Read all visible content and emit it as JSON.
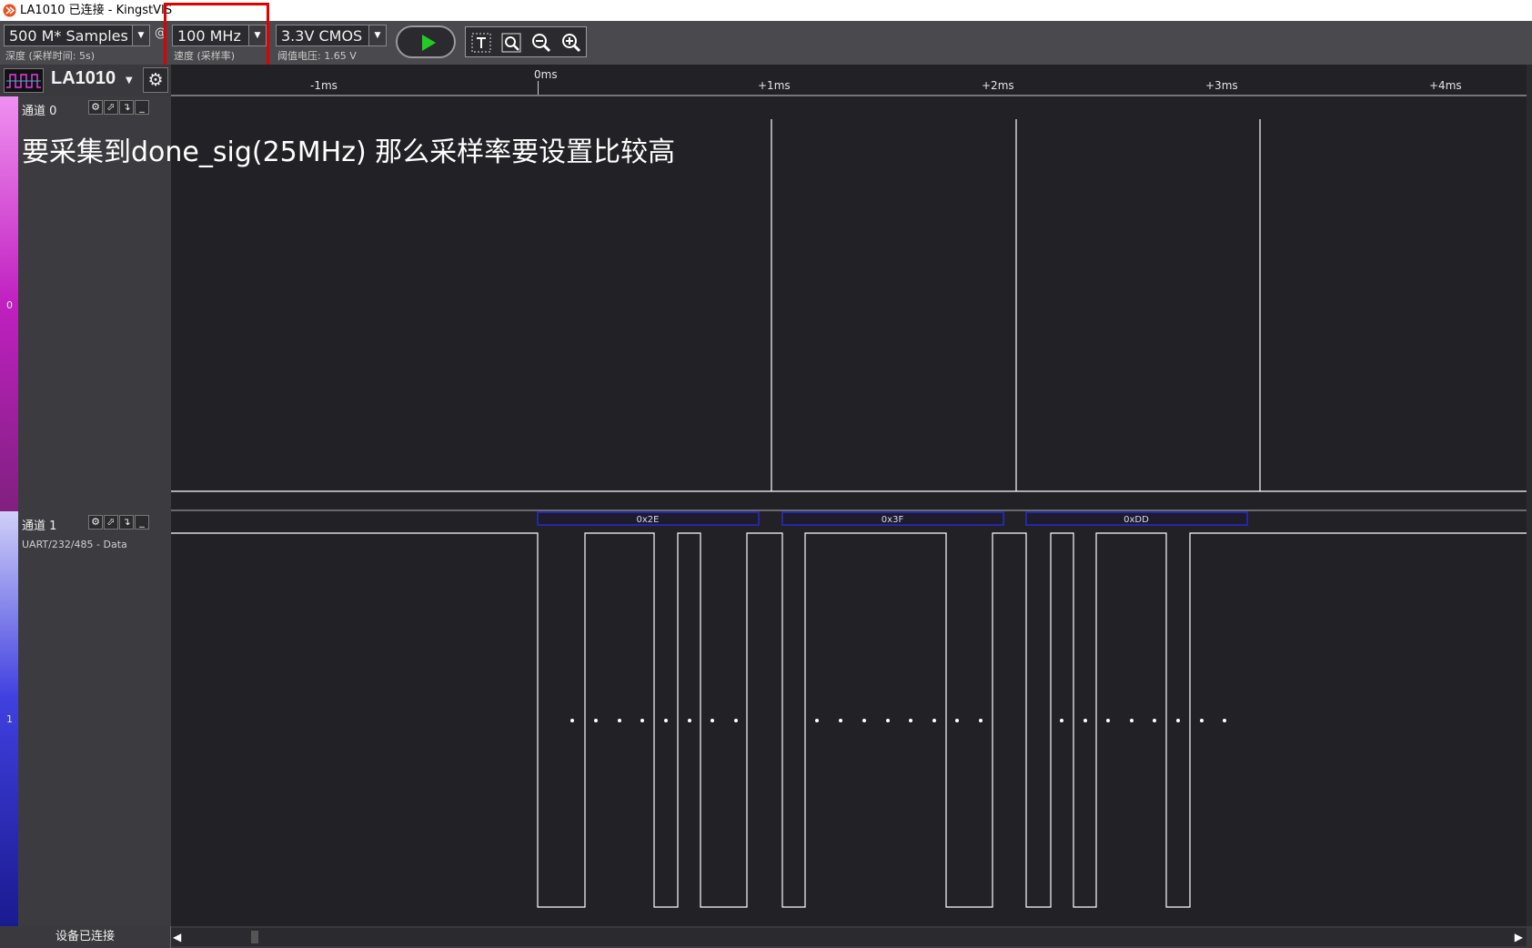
{
  "window": {
    "title": "LA1010 已连接 - KingstVIS",
    "icon": "kingst-logo-icon"
  },
  "toolbar": {
    "samples_value": "500 M* Samples",
    "samples_caption": "深度 (采样时间: 5s)",
    "at_symbol": "@",
    "rate_value": "100 MHz",
    "rate_caption": "速度 (采样率)",
    "voltage_value": "3.3V CMOS",
    "voltage_caption": "阈值电压: 1.65 V",
    "run_icon": "play-icon",
    "tools": [
      "text-cursor-icon",
      "zoom-fit-icon",
      "zoom-out-icon",
      "zoom-in-icon"
    ],
    "highlight_color": "#e00000"
  },
  "device": {
    "name": "LA1010",
    "icon": "waveform-icon",
    "settings_icon": "gear-icon"
  },
  "ruler": {
    "ticks": [
      {
        "label": "-1ms"
      },
      {
        "label": "0ms"
      },
      {
        "label": "+1ms"
      },
      {
        "label": "+2ms"
      },
      {
        "label": "+3ms"
      },
      {
        "label": "+4ms"
      }
    ]
  },
  "channels": [
    {
      "name": "通道 0",
      "index_label": "0",
      "subtitle": "",
      "strip_color": "#d040d0"
    },
    {
      "name": "通道 1",
      "index_label": "1",
      "subtitle": "UART/232/485 - Data",
      "strip_color": "#3030d0"
    }
  ],
  "channel_buttons": [
    "gear-icon",
    "rising-edge-icon",
    "falling-edge-icon",
    "low-level-icon"
  ],
  "annotation": "要采集到done_sig(25MHz) 那么采样率要设置比较高",
  "decoded_bytes": [
    "0x2E",
    "0x3F",
    "0xDD"
  ],
  "status": {
    "text": "设备已连接"
  },
  "colors": {
    "background": "#212126",
    "waveform": "#ffffff",
    "decode_bar": "#2020c0"
  }
}
